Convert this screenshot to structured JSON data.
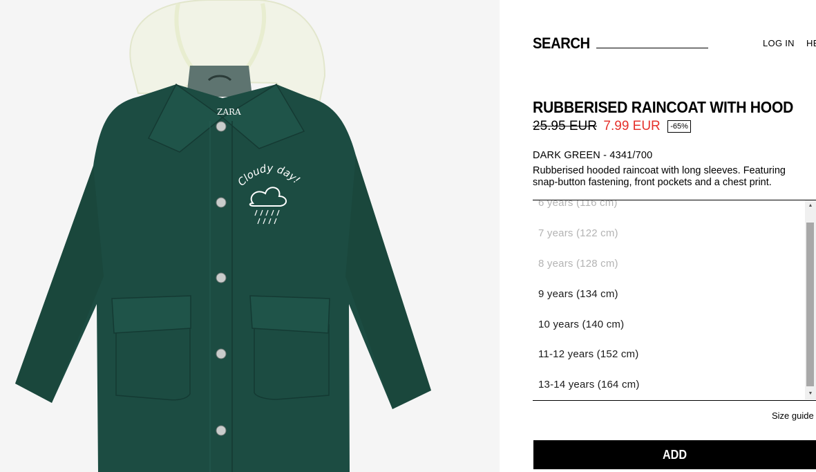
{
  "header": {
    "search_label": "SEARCH",
    "login_label": "LOG IN",
    "help_label": "HE"
  },
  "product": {
    "image_icon": "raincoat-photo",
    "brand_label": "ZARA",
    "print_text": "Cloudy day!",
    "title": "RUBBERISED RAINCOAT WITH HOOD",
    "old_price": "25.95 EUR",
    "new_price": "7.99 EUR",
    "discount": "-65%",
    "color_ref": "DARK GREEN - 4341/700",
    "description_lines": [
      "Rubberised hooded raincoat with long sleeves. Featuring",
      "snap-button fastening, front pockets and a chest print."
    ]
  },
  "sizes": [
    {
      "label": "6 years (116 cm)",
      "available": false
    },
    {
      "label": "7 years (122 cm)",
      "available": false
    },
    {
      "label": "8 years (128 cm)",
      "available": false
    },
    {
      "label": "9 years (134 cm)",
      "available": true
    },
    {
      "label": "10 years (140 cm)",
      "available": true
    },
    {
      "label": "11-12 years (152 cm)",
      "available": true
    },
    {
      "label": "13-14 years (164 cm)",
      "available": true
    }
  ],
  "size_guide_label": "Size guide",
  "add_label": "ADD",
  "colors": {
    "coat_green": "#1c4c42",
    "sale_red": "#e5302a",
    "disabled_text": "#b3b3b3",
    "button_bg": "#000000"
  }
}
